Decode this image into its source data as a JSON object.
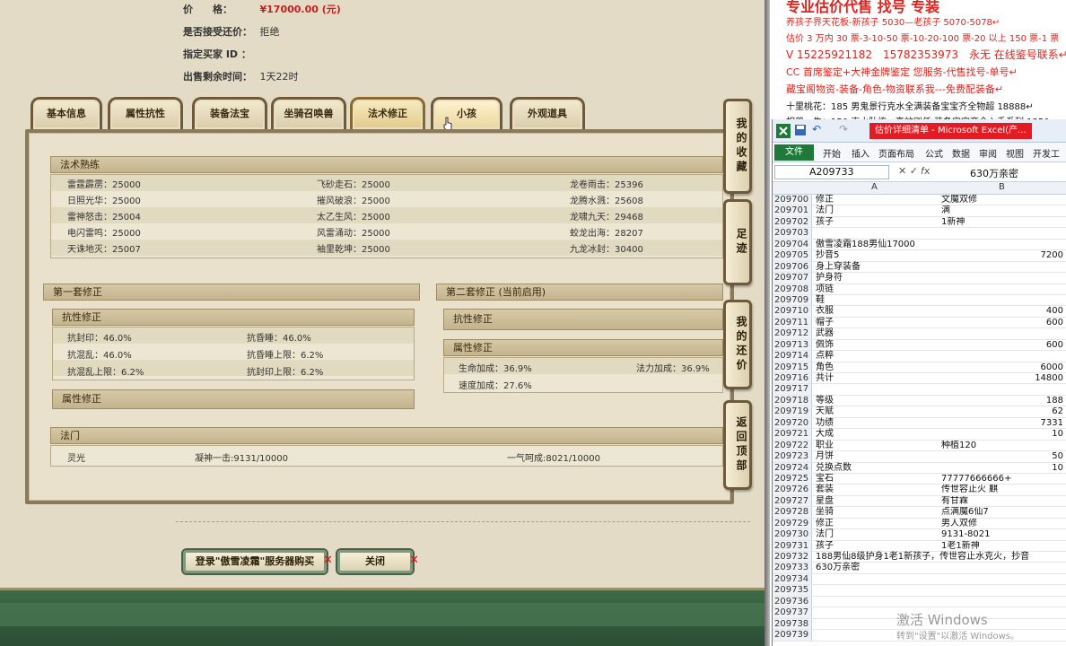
{
  "info": {
    "price_label": "价　　格：",
    "price_value": "¥17000.00 (元)",
    "bargain_label": "是否接受还价：",
    "bargain_value": "拒绝",
    "buyer_label": "指定买家 ID ：",
    "buyer_value": "",
    "time_label": "出售剩余时间：",
    "time_value": "1天22时"
  },
  "tabs": [
    "基本信息",
    "属性抗性",
    "装备法宝",
    "坐骑召唤兽",
    "法术修正",
    "小孩",
    "外观道具"
  ],
  "skills": {
    "title": "法术熟练",
    "rows": [
      [
        "雷霆霹雳：25000",
        "飞砂走石：25000",
        "龙卷雨击：25396"
      ],
      [
        "日照光华：25000",
        "摧风破浪：25000",
        "龙腾水溅：25608"
      ],
      [
        "雷神怒击：25004",
        "太乙生风：25000",
        "龙啸九天：29468"
      ],
      [
        "电闪雷鸣：25000",
        "风雷涌动：25000",
        "蛟龙出海：28207"
      ],
      [
        "天诛地灭：25007",
        "袖里乾坤：25000",
        "九龙冰封：30400"
      ]
    ]
  },
  "set1": {
    "title": "第一套修正",
    "resist_title": "抗性修正",
    "resist": [
      [
        "抗封印：46.0%",
        "抗昏睡：46.0%"
      ],
      [
        "抗混乱：46.0%",
        "抗昏睡上限：6.2%"
      ],
      [
        "抗混乱上限：6.2%",
        "抗封印上限：6.2%"
      ]
    ],
    "attr_title": "属性修正"
  },
  "set2": {
    "title": "第二套修正 (当前启用)",
    "resist_title": "抗性修正",
    "attr_title": "属性修正",
    "attr": [
      [
        "生命加成：36.9%",
        "法力加成：36.9%"
      ],
      [
        "速度加成：27.6%",
        ""
      ]
    ]
  },
  "fabao": {
    "title": "法门",
    "items": [
      "灵光",
      "凝神一击:9131/10000",
      "一气呵成:8021/10000"
    ]
  },
  "side_buttons": [
    "我的收藏",
    "足迹",
    "我的还价",
    "返回顶部"
  ],
  "bottom_buttons": {
    "login": "登录\"傲雪凌霜\"服务器购买",
    "close": "关闭"
  },
  "doc": {
    "lines": [
      {
        "text": "专业估价代售 找号 专装",
        "color": "red"
      },
      {
        "text": "养孩子界天花板-新孩子 5030—老孩子 5070-5078↵",
        "color": "red"
      },
      {
        "text": "估价 3 万内 30 票-3-10-50 票-10-20-100 票-20 以上 150 票-1 票",
        "color": "red"
      },
      {
        "text": "V 15225921182　15782353973　永无  在线鉴号联系↵",
        "color": "red"
      },
      {
        "text": "CC 首席鉴定+大神金牌鉴定 您服务-代售找号-单号↵",
        "color": "red"
      },
      {
        "text": "藏宝阁物资-装备-角色-物资联系我---免费配装备↵",
        "color": "red"
      },
      {
        "text": "十里桃花：185 男鬼景行克水全满装备宝宝齐全物超 18888↵",
        "color": "black"
      },
      {
        "text": "相册一生：150 克水队练 · 高效刷任 装备宝宝齐全入手系列 1350",
        "color": "black"
      }
    ]
  },
  "excel": {
    "window_title": "估价详细清单 - Microsoft Excel(产...",
    "ribbon": [
      "文件",
      "开始",
      "插入",
      "页面布局",
      "公式",
      "数据",
      "审阅",
      "视图",
      "开发工具"
    ],
    "name_box": "A209733",
    "formula": "630万亲密",
    "col_a": "A",
    "col_b": "B",
    "rows": [
      [
        "209700",
        "修正",
        "文魔双修"
      ],
      [
        "209701",
        "法门",
        "满"
      ],
      [
        "209702",
        "孩子",
        "1新神"
      ],
      [
        "209703",
        "",
        ""
      ],
      [
        "209704",
        "傲雪凌霜188男仙17000",
        ""
      ],
      [
        "209705",
        "抄音5",
        "7200"
      ],
      [
        "209706",
        "身上穿装备",
        ""
      ],
      [
        "209707",
        "护身符",
        ""
      ],
      [
        "209708",
        "项链",
        ""
      ],
      [
        "209709",
        "鞋",
        ""
      ],
      [
        "209710",
        "衣服",
        "400"
      ],
      [
        "209711",
        "帽子",
        "600"
      ],
      [
        "209712",
        "武器",
        ""
      ],
      [
        "209713",
        "佩饰",
        "600"
      ],
      [
        "209714",
        "点粹",
        ""
      ],
      [
        "209715",
        "角色",
        "6000"
      ],
      [
        "209716",
        "共计",
        "14800"
      ],
      [
        "209717",
        "",
        ""
      ],
      [
        "209718",
        "等级",
        "188"
      ],
      [
        "209719",
        "天赋",
        "62"
      ],
      [
        "209720",
        "功绩",
        "7331"
      ],
      [
        "209721",
        "大成",
        "10"
      ],
      [
        "209722",
        "职业",
        "种植120"
      ],
      [
        "209723",
        "月饼",
        "50"
      ],
      [
        "209724",
        "兑换点数",
        "10"
      ],
      [
        "209725",
        "宝石",
        "77777666666+"
      ],
      [
        "209726",
        "套装",
        "传世容止火 麒"
      ],
      [
        "209727",
        "星盘",
        "有甘霖"
      ],
      [
        "209728",
        "坐骑",
        "点满魔6仙7"
      ],
      [
        "209729",
        "修正",
        "男人双修"
      ],
      [
        "209730",
        "法门",
        "9131-8021"
      ],
      [
        "209731",
        "孩子",
        "1老1新神"
      ],
      [
        "209732",
        "188男仙8级护身1老1新孩子，传世容止水克火，抄音",
        ""
      ],
      [
        "209733",
        "630万亲密",
        ""
      ],
      [
        "209734",
        "",
        ""
      ],
      [
        "209735",
        "",
        ""
      ],
      [
        "209736",
        "",
        ""
      ],
      [
        "209737",
        "",
        ""
      ],
      [
        "209738",
        "",
        ""
      ],
      [
        "209739",
        "",
        ""
      ]
    ],
    "watermark_title": "激活 Windows",
    "watermark_sub": "转到\"设置\"以激活 Windows。"
  }
}
